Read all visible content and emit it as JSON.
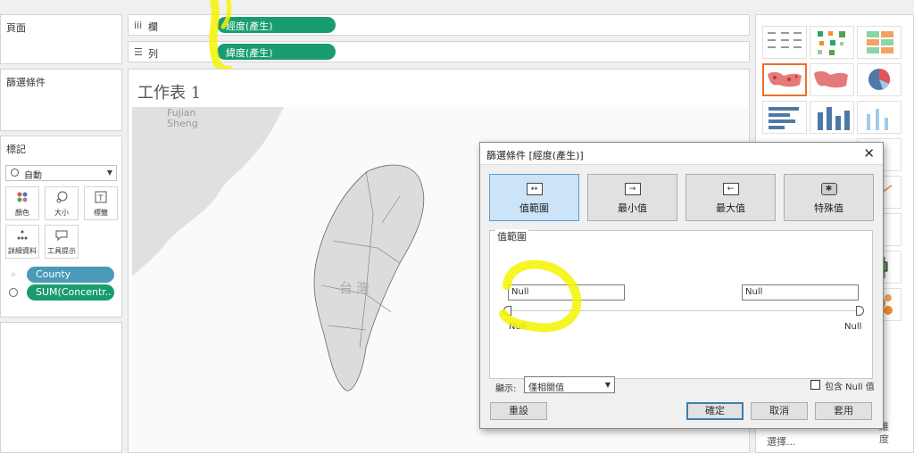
{
  "left_panels": {
    "pages_title": "頁面",
    "filters_title": "篩選條件",
    "marks_title": "標記",
    "mark_type": "自動",
    "mark_buttons": [
      {
        "label": "顏色",
        "icon": "color-icon"
      },
      {
        "label": "大小",
        "icon": "size-icon"
      },
      {
        "label": "標籤",
        "icon": "label-icon"
      },
      {
        "label": "詳細資料",
        "icon": "detail-icon"
      },
      {
        "label": "工具提示",
        "icon": "tooltip-icon"
      }
    ],
    "mark_fields": [
      {
        "label": "County",
        "icon": "detail-icon"
      },
      {
        "label": "SUM(Concentr..",
        "icon": "size-icon"
      }
    ]
  },
  "shelves": {
    "columns_label": "欄",
    "columns_pill": "經度(產生)",
    "rows_label": "列",
    "rows_pill": "緯度(產生)"
  },
  "worksheet": {
    "title": "工作表 1",
    "map_labels": [
      "Fujian",
      "Sheng",
      "台灣"
    ]
  },
  "show_me": {
    "caption_partial": "選擇...",
    "caption_tail": "維 度"
  },
  "dialog": {
    "title": "篩選條件 [經度(產生)]",
    "tabs": [
      {
        "label": "值範圍",
        "active": true
      },
      {
        "label": "最小值",
        "active": false
      },
      {
        "label": "最大值",
        "active": false
      },
      {
        "label": "特殊值",
        "active": false
      }
    ],
    "group_label": "值範圍",
    "min_input": "Null",
    "max_input": "Null",
    "min_caption": "Null",
    "max_caption": "Null",
    "display_label": "顯示:",
    "display_value": "僅相關值",
    "include_null_label": "包含 Null 值",
    "include_null_checked": false,
    "reset_button": "重設",
    "ok_button": "確定",
    "cancel_button": "取消",
    "apply_button": "套用"
  },
  "colors": {
    "pill_green": "#1a9d6e",
    "pill_blue": "#4a9bb7",
    "highlight": "#f5f500",
    "accent": "#3c7fb1"
  }
}
